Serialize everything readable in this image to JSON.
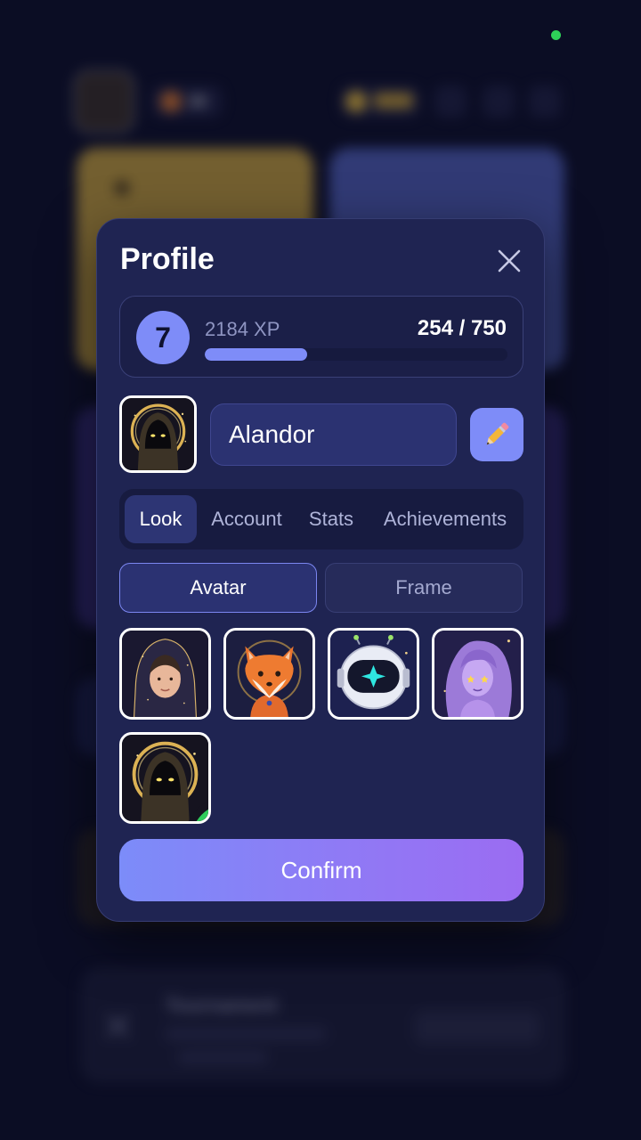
{
  "background": {
    "streak_value": "30",
    "bottom_card_title": "Tournament"
  },
  "modal": {
    "title": "Profile",
    "close_icon": "close-icon"
  },
  "xp": {
    "level": "7",
    "total_label": "2184 XP",
    "progress_label": "254 / 750",
    "progress_fraction": 0.339
  },
  "profile": {
    "username": "Alandor",
    "edit_icon": "pencil-icon"
  },
  "tabs": [
    {
      "label": "Look",
      "active": true
    },
    {
      "label": "Account",
      "active": false
    },
    {
      "label": "Stats",
      "active": false
    },
    {
      "label": "Achievements",
      "active": false
    }
  ],
  "subtabs": [
    {
      "label": "Avatar",
      "active": true
    },
    {
      "label": "Frame",
      "active": false
    }
  ],
  "avatars": [
    {
      "name": "hooded-woman-avatar",
      "selected": false
    },
    {
      "name": "fox-avatar",
      "selected": false
    },
    {
      "name": "robot-avatar",
      "selected": false
    },
    {
      "name": "cosmic-woman-avatar",
      "selected": false
    },
    {
      "name": "hooded-figure-avatar",
      "selected": true
    }
  ],
  "confirm_label": "Confirm",
  "colors": {
    "accent": "#7e8cf8",
    "modal_bg": "#1f2452",
    "selected_check": "#2ecc5a"
  }
}
